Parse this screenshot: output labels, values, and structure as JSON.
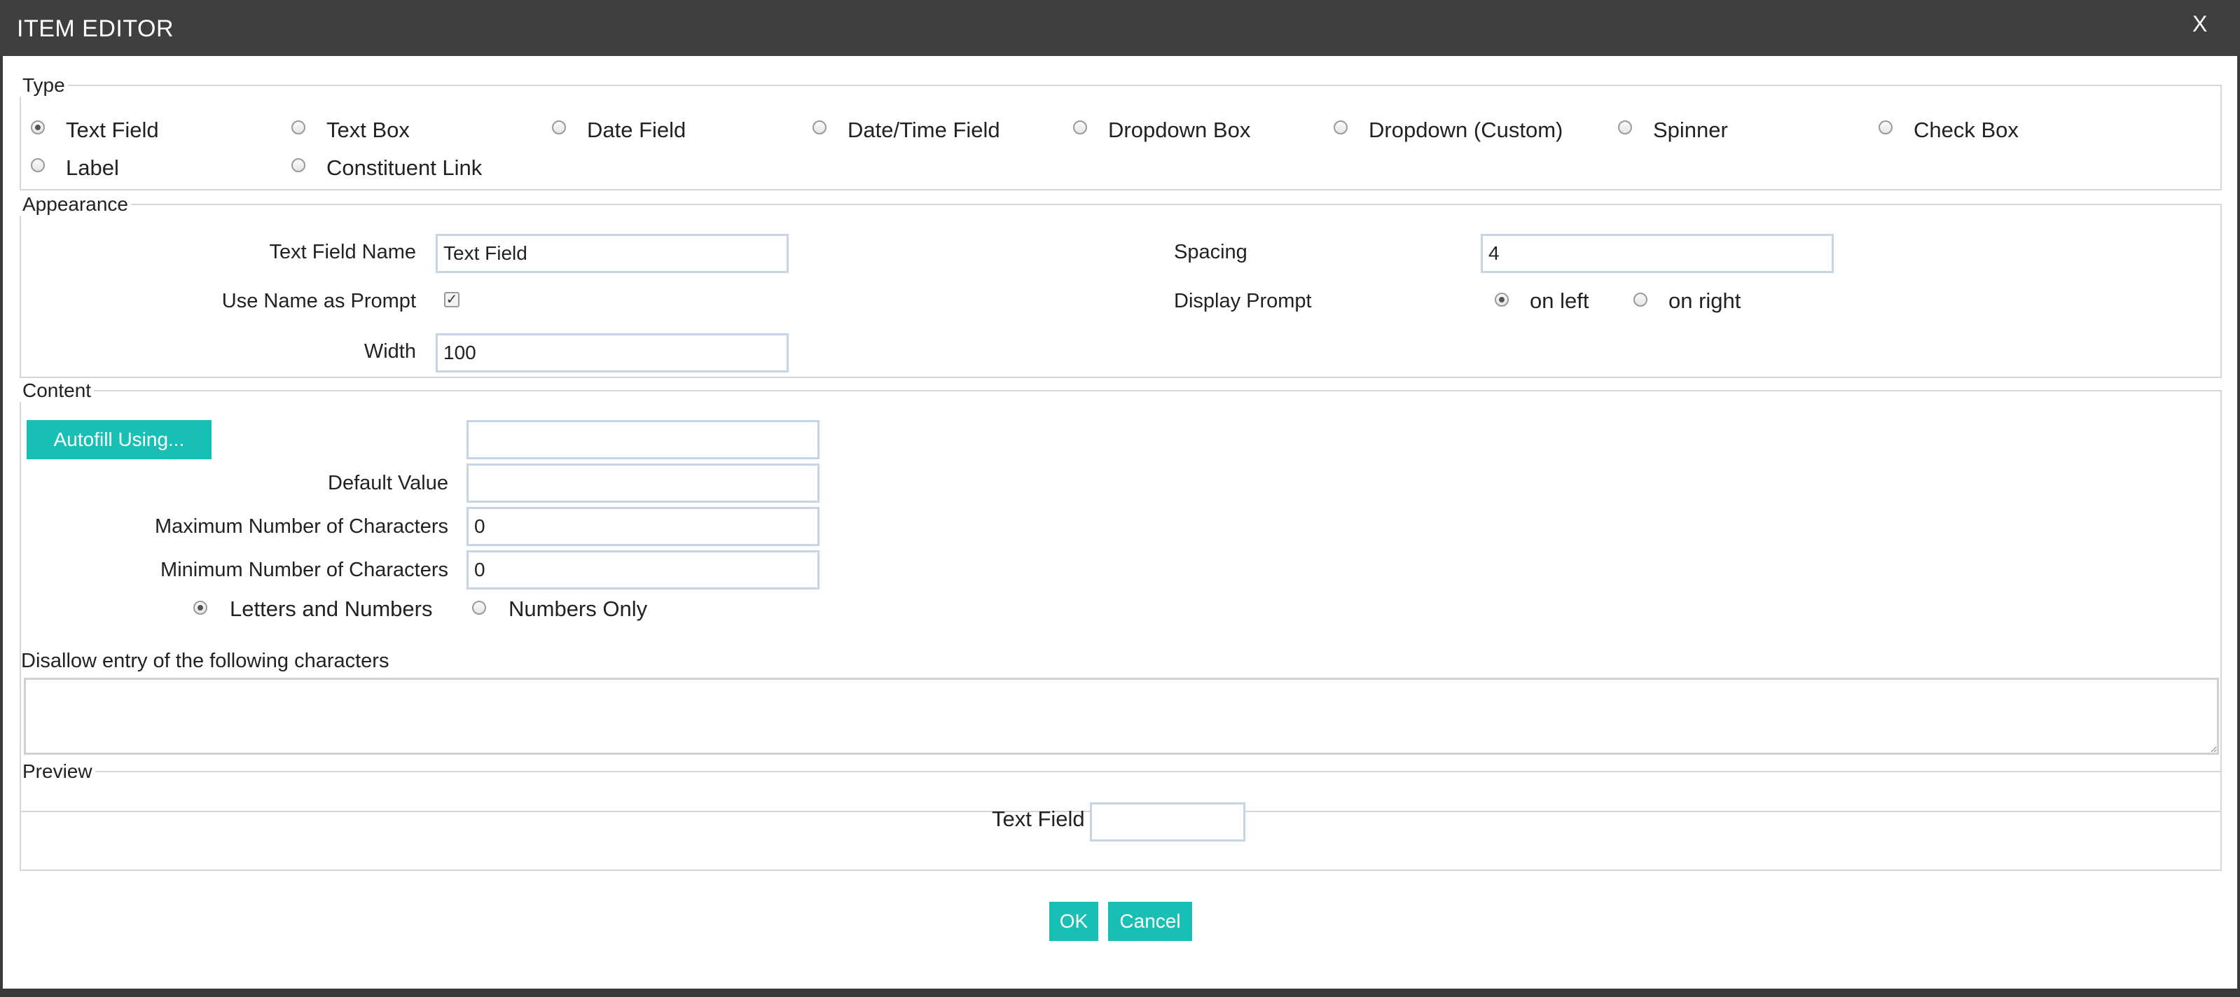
{
  "window": {
    "title": "ITEM EDITOR",
    "close_label": "X"
  },
  "type_section": {
    "legend": "Type",
    "options": [
      {
        "label": "Text Field",
        "selected": true
      },
      {
        "label": "Text Box",
        "selected": false
      },
      {
        "label": "Date Field",
        "selected": false
      },
      {
        "label": "Date/Time Field",
        "selected": false
      },
      {
        "label": "Dropdown Box",
        "selected": false
      },
      {
        "label": "Dropdown (Custom)",
        "selected": false
      },
      {
        "label": "Spinner",
        "selected": false
      },
      {
        "label": "Check Box",
        "selected": false
      },
      {
        "label": "Label",
        "selected": false
      },
      {
        "label": "Constituent Link",
        "selected": false
      }
    ]
  },
  "appearance": {
    "legend": "Appearance",
    "name_label": "Text Field Name",
    "name_value": "Text Field",
    "use_name_label": "Use Name as Prompt",
    "use_name_checked": true,
    "width_label": "Width",
    "width_value": "100",
    "spacing_label": "Spacing",
    "spacing_value": "4",
    "display_prompt_label": "Display Prompt",
    "prompt_options": [
      {
        "label": "on left",
        "selected": true
      },
      {
        "label": "on right",
        "selected": false
      }
    ]
  },
  "content": {
    "legend": "Content",
    "autofill_button": "Autofill Using...",
    "autofill_value": "",
    "default_label": "Default Value",
    "default_value": "",
    "max_label": "Maximum Number of Characters",
    "max_value": "0",
    "min_label": "Minimum Number of Characters",
    "min_value": "0",
    "char_options": [
      {
        "label": "Letters and Numbers",
        "selected": true
      },
      {
        "label": "Numbers Only",
        "selected": false
      }
    ],
    "disallow_label": "Disallow entry of the following characters",
    "disallow_value": ""
  },
  "preview": {
    "legend": "Preview",
    "field_label": "Text Field",
    "field_value": ""
  },
  "footer": {
    "ok_label": "OK",
    "cancel_label": "Cancel"
  },
  "colors": {
    "accent": "#17bfb5",
    "titlebar": "#3f3f3f",
    "input_border": "#c7d4e4"
  }
}
